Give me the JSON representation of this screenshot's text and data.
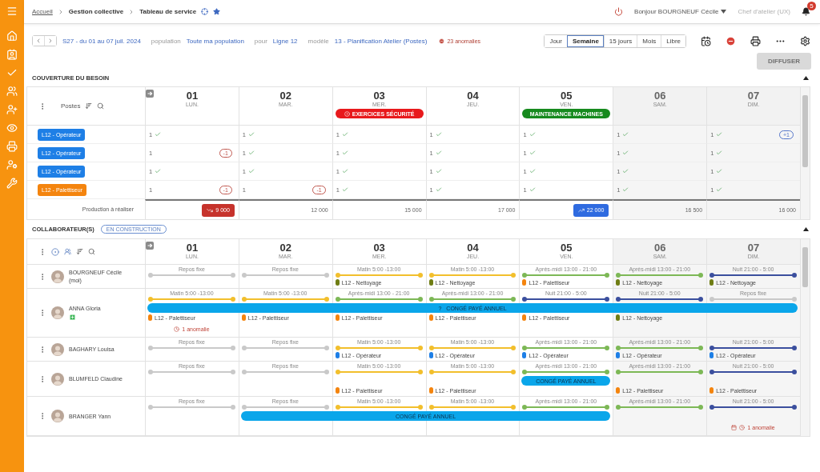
{
  "topbar": {
    "breadcrumb": [
      {
        "label": "Accueil",
        "link": true
      },
      {
        "label": "Gestion collective",
        "link": false
      },
      {
        "label": "Tableau de service",
        "link": false
      }
    ],
    "greeting": "Bonjour BOURGNEUF Cécile",
    "role": "Chef d'atelier (UX)",
    "notifications": "5"
  },
  "toolbar": {
    "period": "S27 - du 01 au 07 juil. 2024",
    "filters": [
      {
        "label": "population",
        "value": "Toute ma population"
      },
      {
        "label": "pour",
        "value": "Ligne 12"
      },
      {
        "label": "modèle",
        "value": "13 - Planification Atelier (Postes)"
      }
    ],
    "anomalies": "23 anomalies",
    "views": [
      {
        "label": "Jour",
        "selected": false
      },
      {
        "label": "Semaine",
        "selected": true
      },
      {
        "label": "15 jours",
        "selected": false
      },
      {
        "label": "Mois",
        "selected": false
      },
      {
        "label": "Libre",
        "selected": false
      }
    ],
    "publish": {
      "label": "DIFFUSER",
      "disabled": true
    }
  },
  "coverage": {
    "title": "COUVERTURE DU BESOIN",
    "column_label": "Postes",
    "days": [
      {
        "number": "01",
        "name": "LUN.",
        "weekend": false
      },
      {
        "number": "02",
        "name": "MAR.",
        "weekend": false
      },
      {
        "number": "03",
        "name": "MER.",
        "weekend": false,
        "event": {
          "label": "EXERCICES SÉCURITÉ",
          "kind": "safety",
          "color": "#e8191c"
        }
      },
      {
        "number": "04",
        "name": "JEU.",
        "weekend": false
      },
      {
        "number": "05",
        "name": "VEN.",
        "weekend": false,
        "event": {
          "label": "MAINTENANCE MACHINES",
          "kind": "maintenance",
          "color": "#168a1e"
        }
      },
      {
        "number": "06",
        "name": "SAM.",
        "weekend": true
      },
      {
        "number": "07",
        "name": "DIM.",
        "weekend": true
      }
    ],
    "rows": [
      {
        "post": "L12 - Opérateur",
        "color": "#1e7fe6",
        "cells": [
          {
            "value": "1",
            "ok": true
          },
          {
            "value": "1",
            "ok": true
          },
          {
            "value": "1",
            "ok": true
          },
          {
            "value": "1",
            "ok": true
          },
          {
            "value": "1",
            "ok": true
          },
          {
            "value": "1",
            "ok": true
          },
          {
            "value": "1",
            "ok": true,
            "badge": {
              "text": "+1",
              "kind": "surplus"
            }
          }
        ]
      },
      {
        "post": "L12 - Opérateur",
        "color": "#1e7fe6",
        "cells": [
          {
            "value": "1",
            "ok": false,
            "badge": {
              "text": "-1",
              "kind": "deficit"
            }
          },
          {
            "value": "1",
            "ok": true
          },
          {
            "value": "1",
            "ok": true
          },
          {
            "value": "1",
            "ok": true
          },
          {
            "value": "1",
            "ok": true
          },
          {
            "value": "1",
            "ok": true
          },
          {
            "value": "1",
            "ok": true
          }
        ]
      },
      {
        "post": "L12 - Opérateur",
        "color": "#1e7fe6",
        "cells": [
          {
            "value": "1",
            "ok": true
          },
          {
            "value": "1",
            "ok": true
          },
          {
            "value": "1",
            "ok": true
          },
          {
            "value": "1",
            "ok": true
          },
          {
            "value": "1",
            "ok": true
          },
          {
            "value": "1",
            "ok": true
          },
          {
            "value": "1",
            "ok": true
          }
        ]
      },
      {
        "post": "L12 - Palettiseur",
        "color": "#f4840e",
        "cells": [
          {
            "value": "1",
            "ok": false,
            "badge": {
              "text": "-1",
              "kind": "deficit"
            }
          },
          {
            "value": "1",
            "ok": false,
            "badge": {
              "text": "-1",
              "kind": "deficit"
            }
          },
          {
            "value": "1",
            "ok": true
          },
          {
            "value": "1",
            "ok": true
          },
          {
            "value": "1",
            "ok": true
          },
          {
            "value": "1",
            "ok": true
          },
          {
            "value": "1",
            "ok": true
          }
        ]
      }
    ],
    "production": {
      "label": "Production à réaliser",
      "values": [
        {
          "value": "9 000",
          "kind": "low"
        },
        {
          "value": "12 000",
          "kind": "normal"
        },
        {
          "value": "15 000",
          "kind": "normal"
        },
        {
          "value": "17 000",
          "kind": "normal"
        },
        {
          "value": "22 000",
          "kind": "high"
        },
        {
          "value": "16 500",
          "kind": "normal"
        },
        {
          "value": "16 000",
          "kind": "normal"
        }
      ]
    }
  },
  "collaborators": {
    "title": "COLLABORATEUR(S)",
    "status": "EN CONSTRUCTION",
    "days": [
      {
        "number": "01",
        "name": "LUN.",
        "weekend": false
      },
      {
        "number": "02",
        "name": "MAR.",
        "weekend": false
      },
      {
        "number": "03",
        "name": "MER.",
        "weekend": false
      },
      {
        "number": "04",
        "name": "JEU.",
        "weekend": false
      },
      {
        "number": "05",
        "name": "VEN.",
        "weekend": false
      },
      {
        "number": "06",
        "name": "SAM.",
        "weekend": true
      },
      {
        "number": "07",
        "name": "DIM.",
        "weekend": true
      }
    ],
    "rows": [
      {
        "name": "BOURGNEUF Cécile",
        "sub": "(moi)",
        "flagged": false,
        "days": [
          {
            "shift": "Repos fixe",
            "kind": "rest"
          },
          {
            "shift": "Repos fixe",
            "kind": "rest"
          },
          {
            "shift": "Matin 5:00 -13:00",
            "kind": "morning",
            "post": {
              "label": "L12 - Nettoyage",
              "color": "#6f7d14"
            }
          },
          {
            "shift": "Matin 5:00 -13:00",
            "kind": "morning",
            "post": {
              "label": "L12 - Nettoyage",
              "color": "#6f7d14"
            }
          },
          {
            "shift": "Après-midi 13:00 - 21:00",
            "kind": "afternoon",
            "post": {
              "label": "L12 - Palettiseur",
              "color": "#f4840e"
            }
          },
          {
            "shift": "Après-midi 13:00 - 21:00",
            "kind": "afternoon",
            "post": {
              "label": "L12 - Nettoyage",
              "color": "#6f7d14"
            }
          },
          {
            "shift": "Nuit 21:00 - 5:00",
            "kind": "night",
            "post": {
              "label": "L12 - Nettoyage",
              "color": "#6f7d14"
            }
          }
        ]
      },
      {
        "name": "ANNA Gloria",
        "flagged": true,
        "leaves": [
          {
            "label": "CONGÉ PAYÉ ANNUEL",
            "mark": "?"
          }
        ],
        "days": [
          {
            "shift": "Matin 5:00 -13:00",
            "kind": "morning",
            "leave": true,
            "post": {
              "label": "L12 - Palettiseur",
              "color": "#f4840e"
            },
            "anomaly": {
              "text": "1 anomalie",
              "kind": "time"
            }
          },
          {
            "shift": "Matin 5:00 -13:00",
            "kind": "morning",
            "leave": true,
            "post": {
              "label": "L12 - Palettiseur",
              "color": "#f4840e"
            }
          },
          {
            "shift": "Après-midi 13:00 - 21:00",
            "kind": "afternoon",
            "leave": true,
            "post": {
              "label": "L12 - Palettiseur",
              "color": "#f4840e"
            }
          },
          {
            "shift": "Après-midi 13:00 - 21:00",
            "kind": "afternoon",
            "leave": true,
            "post": {
              "label": "L12 - Palettiseur",
              "color": "#f4840e"
            }
          },
          {
            "shift": "Nuit 21:00 - 5:00",
            "kind": "night",
            "leave": true,
            "post": {
              "label": "L12 - Palettiseur",
              "color": "#f4840e"
            }
          },
          {
            "shift": "Nuit 21:00 - 5:00",
            "kind": "night",
            "leave": true,
            "post": {
              "label": "L12 - Nettoyage",
              "color": "#6f7d14"
            }
          },
          {
            "shift": "Repos fixe",
            "kind": "rest",
            "leave": true
          }
        ]
      },
      {
        "name": "BAGHARY Louisa",
        "flagged": false,
        "days": [
          {
            "shift": "Repos fixe",
            "kind": "rest"
          },
          {
            "shift": "Repos fixe",
            "kind": "rest"
          },
          {
            "shift": "Matin 5:00 -13:00",
            "kind": "morning",
            "post": {
              "label": "L12 - Opérateur",
              "color": "#1e7fe6"
            }
          },
          {
            "shift": "Matin 5:00 -13:00",
            "kind": "morning",
            "post": {
              "label": "L12 - Opérateur",
              "color": "#1e7fe6"
            }
          },
          {
            "shift": "Après-midi 13:00 - 21:00",
            "kind": "afternoon",
            "post": {
              "label": "L12 - Opérateur",
              "color": "#1e7fe6"
            }
          },
          {
            "shift": "Après-midi 13:00 - 21:00",
            "kind": "afternoon",
            "post": {
              "label": "L12 - Opérateur",
              "color": "#1e7fe6"
            }
          },
          {
            "shift": "Nuit 21:00 - 5:00",
            "kind": "night",
            "post": {
              "label": "L12 - Opérateur",
              "color": "#1e7fe6"
            }
          }
        ]
      },
      {
        "name": "BLUMFELD Claudine",
        "flagged": false,
        "leaves": [
          {
            "label": "CONGÉ PAYÉ ANNUEL"
          }
        ],
        "days": [
          {
            "shift": "Repos fixe",
            "kind": "rest"
          },
          {
            "shift": "Repos fixe",
            "kind": "rest"
          },
          {
            "shift": "Matin 5:00 -13:00",
            "kind": "morning",
            "post": {
              "label": "L12 - Palettiseur",
              "color": "#f4840e"
            }
          },
          {
            "shift": "Matin 5:00 -13:00",
            "kind": "morning",
            "post": {
              "label": "L12 - Palettiseur",
              "color": "#f4840e"
            }
          },
          {
            "shift": "Après-midi 13:00 - 21:00",
            "kind": "afternoon",
            "leave": true
          },
          {
            "shift": "Après-midi 13:00 - 21:00",
            "kind": "afternoon",
            "post": {
              "label": "L12 - Palettiseur",
              "color": "#f4840e"
            }
          },
          {
            "shift": "Nuit 21:00 - 5:00",
            "kind": "night",
            "post": {
              "label": "L12 - Palettiseur",
              "color": "#f4840e"
            }
          }
        ]
      },
      {
        "name": "BRANGER Yann",
        "flagged": false,
        "leaves": [
          {
            "label": "CONGÉ PAYÉ ANNUEL"
          }
        ],
        "days": [
          {
            "shift": "Repos fixe",
            "kind": "rest"
          },
          {
            "shift": "Repos fixe",
            "kind": "rest",
            "leave": true
          },
          {
            "shift": "Matin 5:00 -13:00",
            "kind": "morning",
            "leave": true
          },
          {
            "shift": "Matin 5:00 -13:00",
            "kind": "morning",
            "leave": true
          },
          {
            "shift": "Après-midi 13:00 - 21:00",
            "kind": "afternoon",
            "leave": true
          },
          {
            "shift": "Après-midi 13:00 - 21:00",
            "kind": "afternoon"
          },
          {
            "shift": "Nuit 21:00 - 5:00",
            "kind": "night",
            "anomaly": {
              "text": "1 anomalie",
              "kind": "planning"
            }
          }
        ]
      }
    ]
  }
}
